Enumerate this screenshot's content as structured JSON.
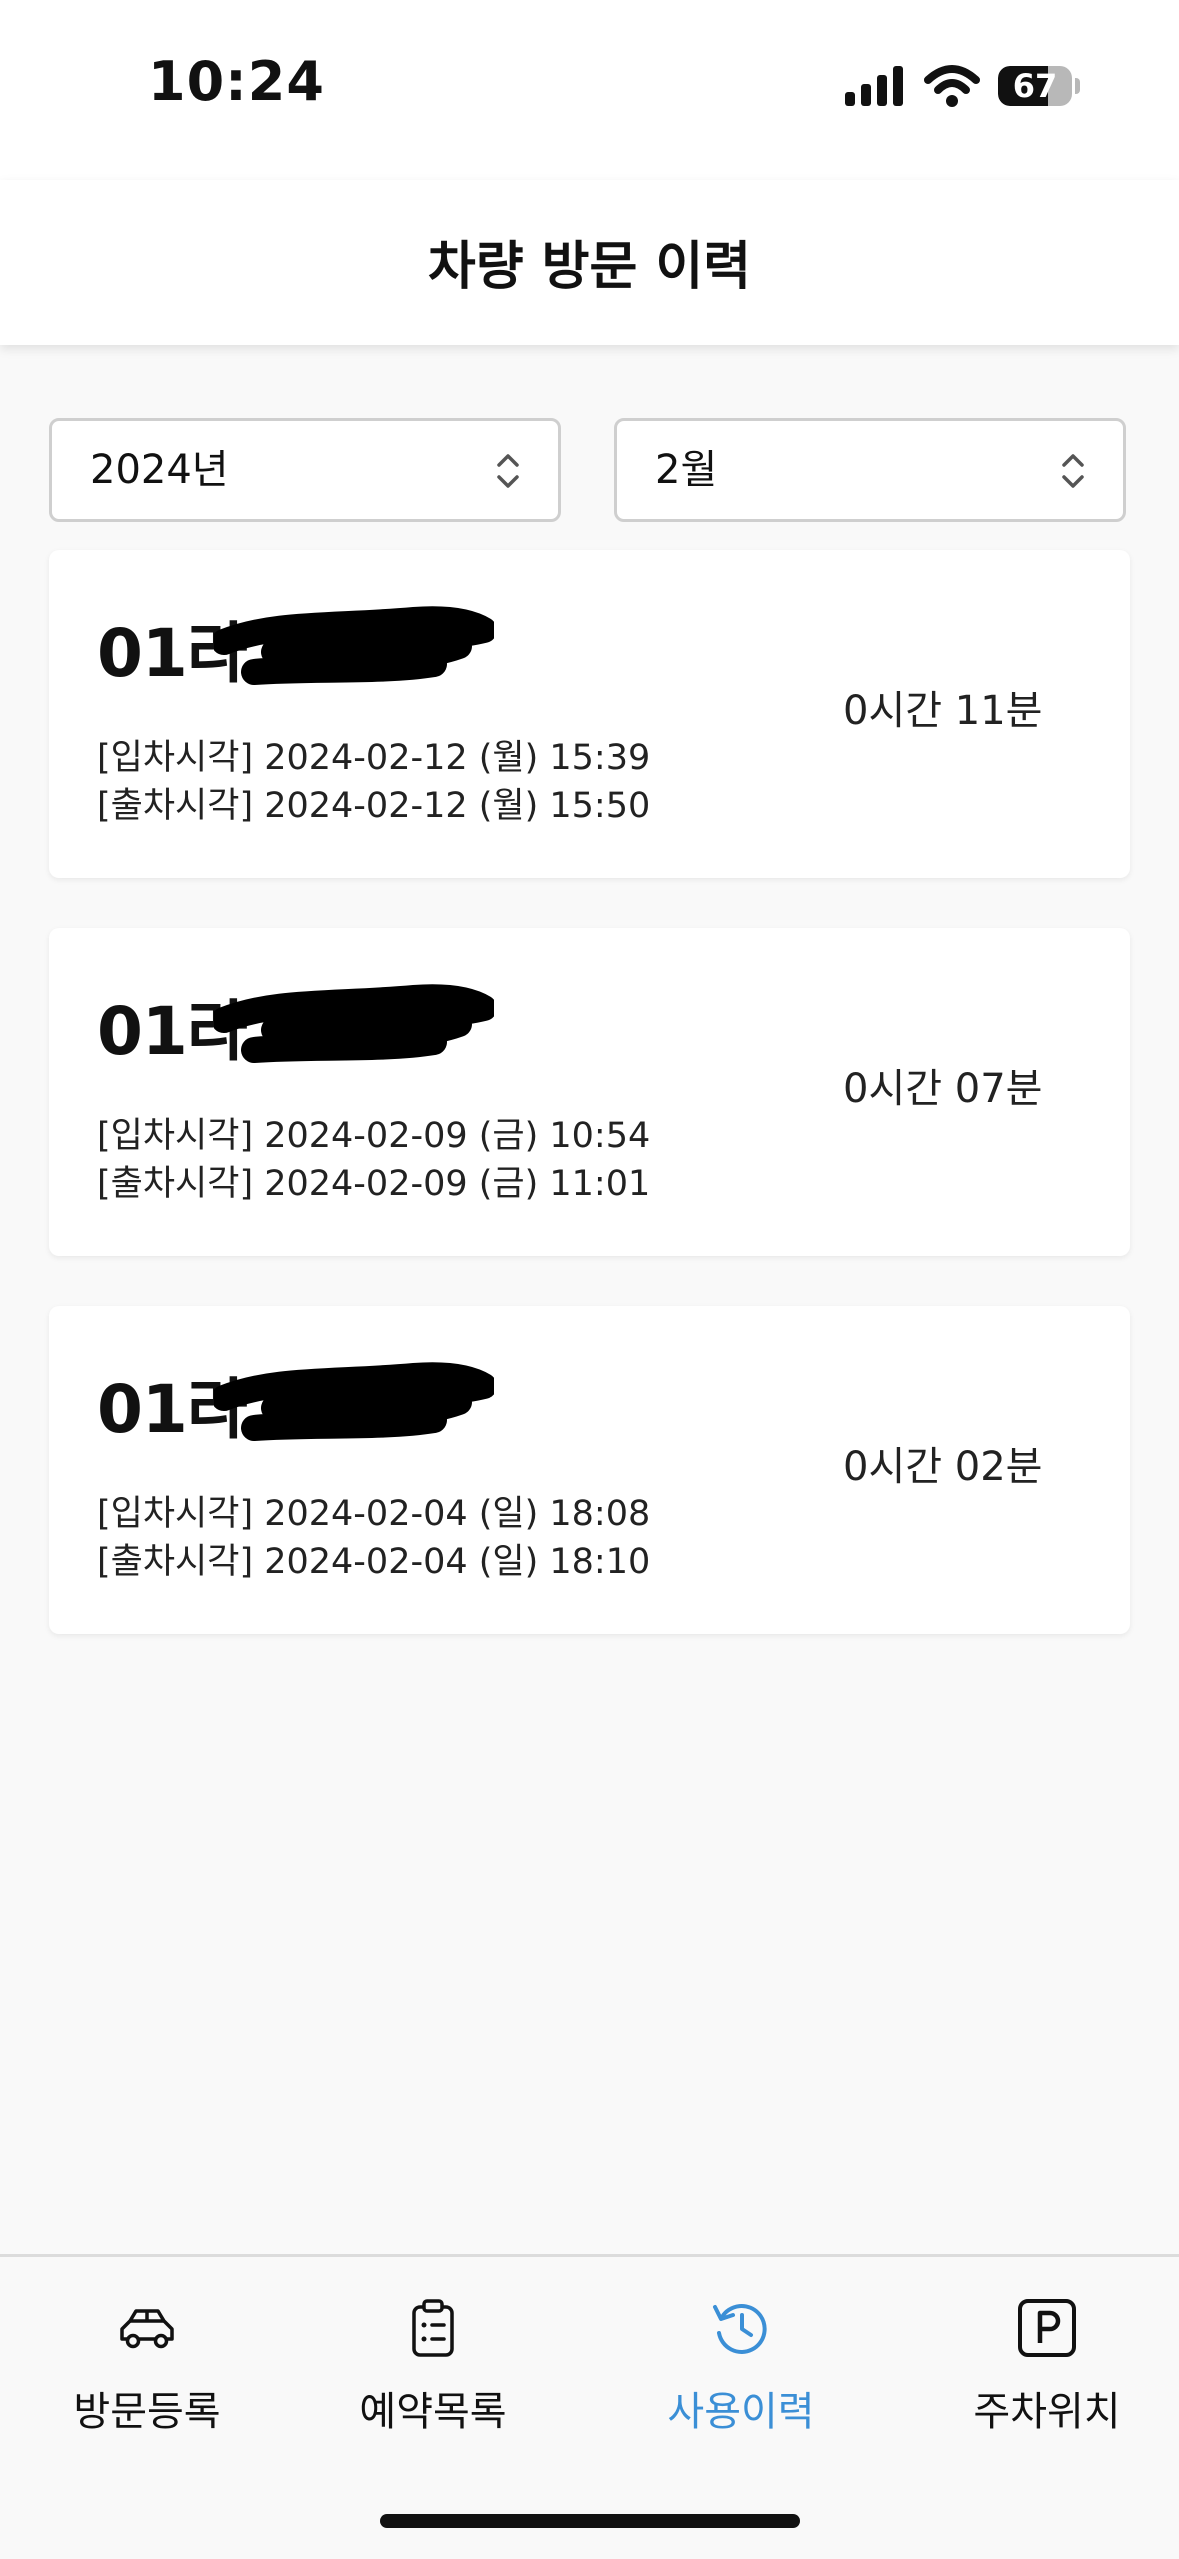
{
  "status_bar": {
    "time": "10:24",
    "battery": "67",
    "battery_level": 0.67
  },
  "header": {
    "title": "차량 방문 이력"
  },
  "filters": {
    "year": "2024년",
    "month": "2월"
  },
  "visits": [
    {
      "plate_visible": "01라",
      "entry": "[입차시각] 2024-02-12 (월) 15:39",
      "exit": "[출차시각] 2024-02-12 (월) 15:50",
      "duration": "0시간 11분"
    },
    {
      "plate_visible": "01라",
      "entry": "[입차시각] 2024-02-09 (금) 10:54",
      "exit": "[출차시각] 2024-02-09 (금) 11:01",
      "duration": "0시간 07분"
    },
    {
      "plate_visible": "01라",
      "entry": "[입차시각] 2024-02-04 (일) 18:08",
      "exit": "[출차시각] 2024-02-04 (일) 18:10",
      "duration": "0시간 02분"
    }
  ],
  "nav": {
    "items": [
      {
        "label": "방문등록",
        "icon": "car-icon",
        "active": false
      },
      {
        "label": "예약목록",
        "icon": "clipboard-icon",
        "active": false
      },
      {
        "label": "사용이력",
        "icon": "history-icon",
        "active": true
      },
      {
        "label": "주차위치",
        "icon": "parking-icon",
        "active": false
      }
    ],
    "active_color": "#3b8fd6"
  }
}
